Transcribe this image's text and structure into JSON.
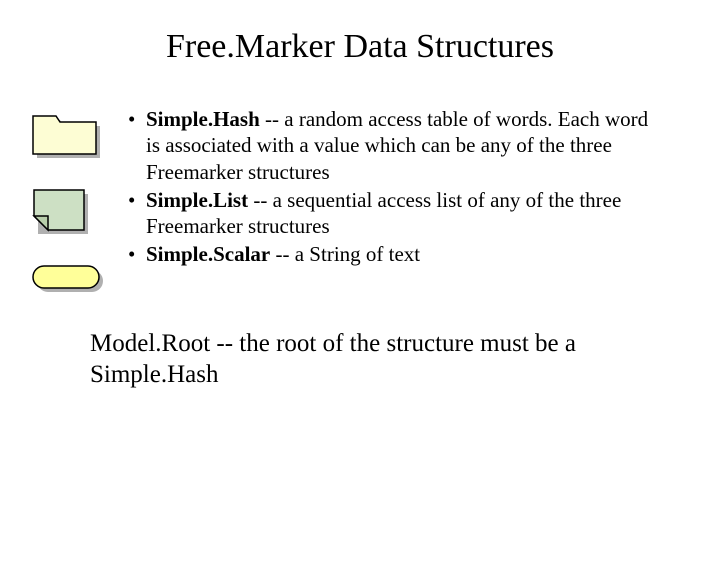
{
  "title": "Free.Marker Data Structures",
  "bullets": [
    {
      "term": "Simple.Hash",
      "desc": " -- a random access table of words. Each word is associated with a value which can be any of the three Freemarker structures"
    },
    {
      "term": "Simple.List",
      "desc": " -- a sequential access list of any of the three Freemarker structures"
    },
    {
      "term": "Simple.Scalar",
      "desc": " -- a String of text"
    }
  ],
  "footer": "Model.Root -- the root of the structure must be a Simple.Hash",
  "dot": "•"
}
